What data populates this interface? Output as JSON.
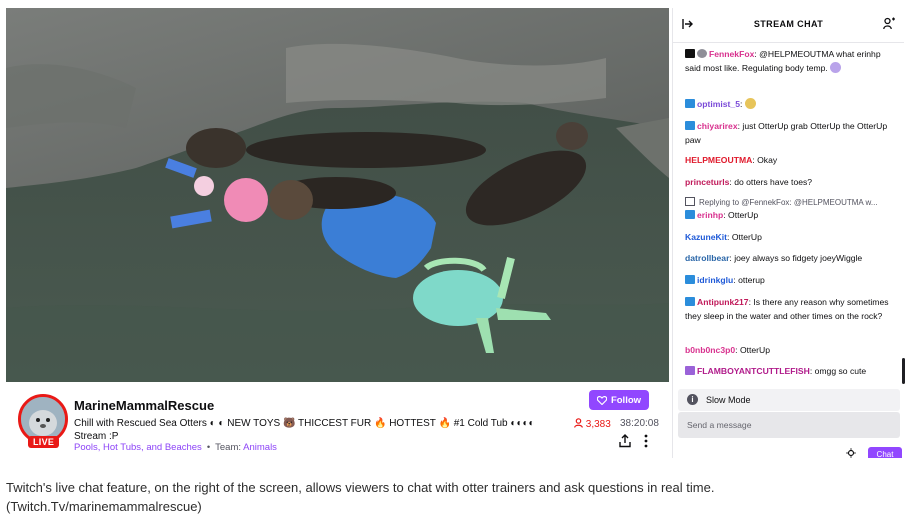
{
  "chat": {
    "title": "STREAM CHAT",
    "messages": [
      {
        "user": "FennekFox",
        "color": "#d8318e",
        "text": "@HELPMEOUTMA what erinhp said most like. Regulating body temp.",
        "badge": "dark"
      },
      {
        "user": "optimist_5",
        "color": "#7a4ad8",
        "text": "",
        "badge": "blue"
      },
      {
        "user": "chiyarirex",
        "color": "#d8318e",
        "text": "just OtterUp grab OtterUp the OtterUp paw",
        "badge": "blue"
      },
      {
        "user": "HELPMEOUTMA",
        "color": "#e01a2c",
        "text": "Okay",
        "badge": ""
      },
      {
        "user": "princeturls",
        "color": "#c01a5a",
        "text": "do otters have toes?",
        "badge": ""
      },
      {
        "user": "erinhp",
        "color": "#d8318e",
        "text": "OtterUp",
        "badge": "blue"
      },
      {
        "user": "KazuneKit",
        "color": "#1f5ad8",
        "text": "OtterUp",
        "badge": ""
      },
      {
        "user": "datrollbear",
        "color": "#2a66a8",
        "text": "joey always so fidgety joeyWiggle",
        "badge": ""
      },
      {
        "user": "idrinkglu",
        "color": "#1f5ad8",
        "text": "otterup",
        "badge": "blue"
      },
      {
        "user": "Antipunk217",
        "color": "#c01a5a",
        "text": "Is there any reason why sometimes they sleep in the water and other times on the rock?",
        "badge": "blue"
      },
      {
        "user": "b0nb0nc3p0",
        "color": "#d8318e",
        "text": "OtterUp",
        "badge": ""
      },
      {
        "user": "FLAMBOYANTCUTTLEFISH",
        "color": "#b01a8a",
        "text": "omgg so cute",
        "badge": "purple"
      }
    ],
    "reply_context": "Replying to @FennekFox: @HELPMEOUTMA w...",
    "slow_mode_label": "Slow Mode",
    "input_placeholder": "Send a message",
    "chat_button_label": "Chat"
  },
  "channel": {
    "name": "MarineMammalRescue",
    "live_label": "LIVE",
    "title": "Chill with Rescued Sea Otters ◐ ◐ NEW TOYS 🐻 THICCEST FUR 🔥 HOTTEST 🔥 #1 Cold Tub ◐◐◐◐ Stream :P",
    "tag_1": "Pools, Hot Tubs, and Beaches",
    "team_label": "Team:",
    "team_name": "Animals",
    "follow_label": "Follow",
    "viewer_count": "3,383",
    "uptime": "38:20:08"
  },
  "caption": "Twitch's live chat feature, on the right of the screen, allows viewers to chat with otter trainers and ask questions in real time. (Twitch.Tv/marinemammalrescue)",
  "colors": {
    "twitch_purple": "#9147ff",
    "live_red": "#e91916",
    "link_purple": "#8d44f7"
  },
  "icons": [
    "collapse-chat-icon",
    "community-users-icon",
    "heart-icon",
    "viewer-person-icon",
    "share-icon",
    "more-options-icon",
    "info-icon",
    "settings-gear-icon"
  ]
}
